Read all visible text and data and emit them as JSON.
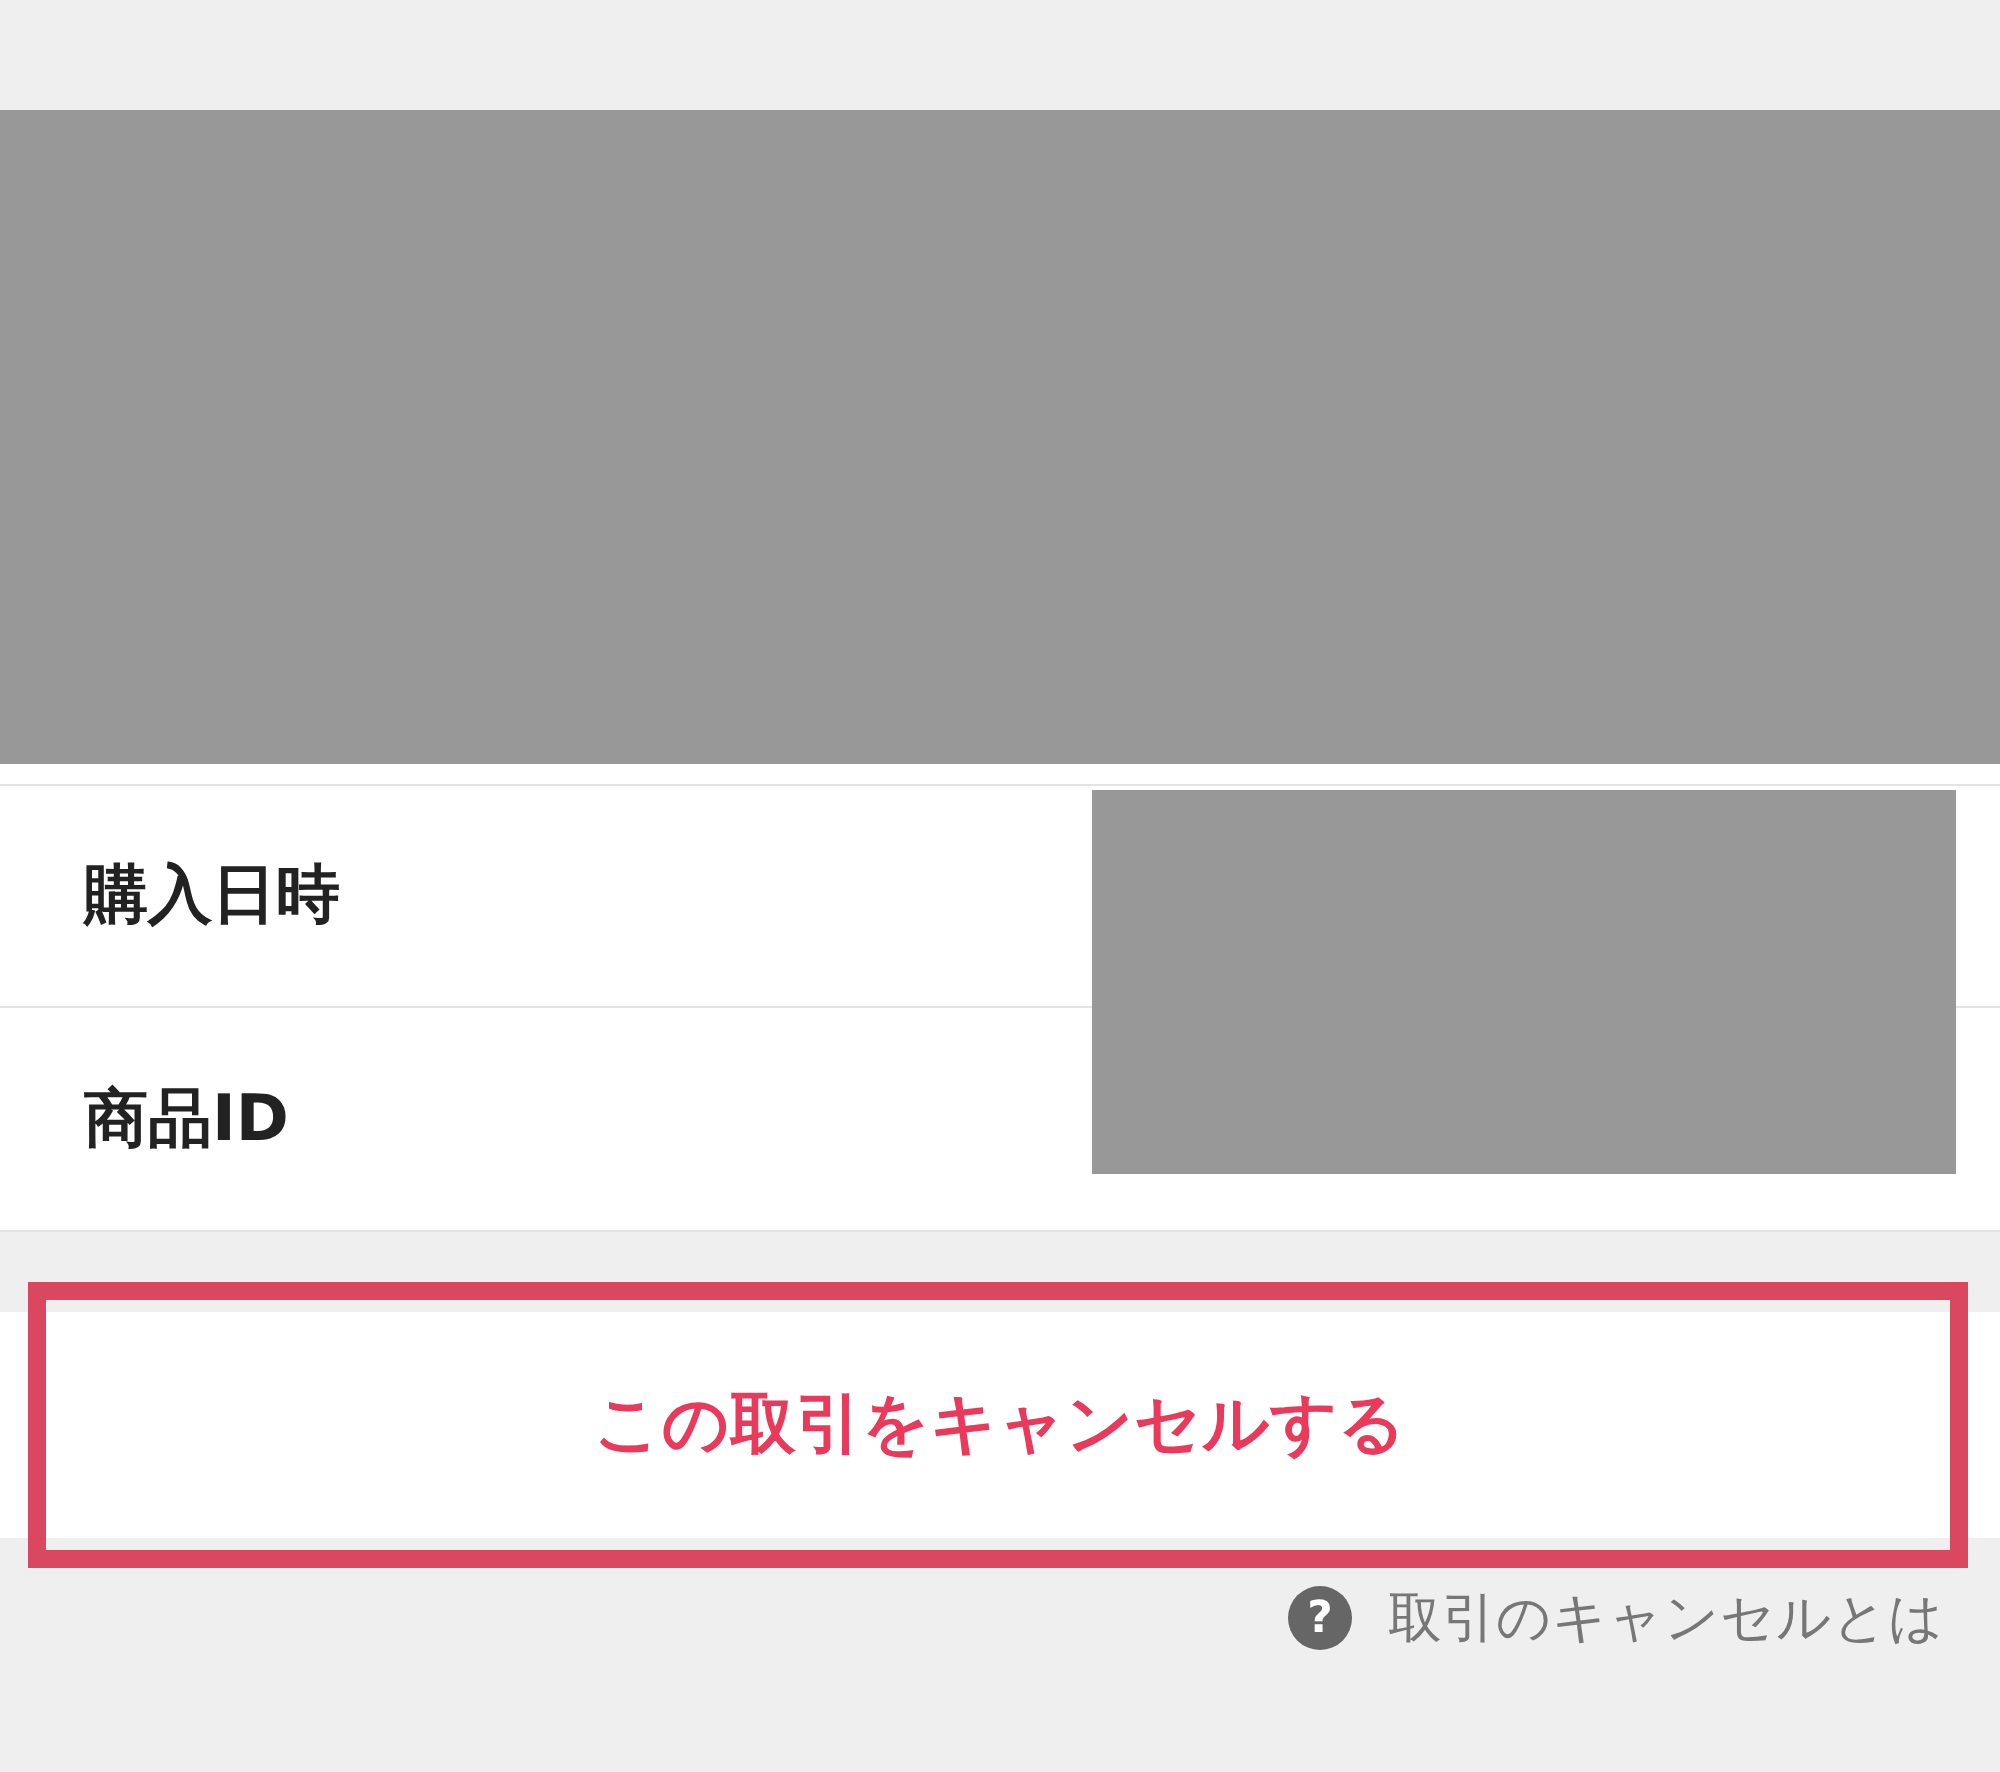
{
  "details": [
    {
      "label": "購入日時"
    },
    {
      "label": "商品ID"
    }
  ],
  "cancel_button": {
    "label": "この取引をキャンセルする"
  },
  "help_link": {
    "icon": "?",
    "label": "取引のキャンセルとは"
  }
}
